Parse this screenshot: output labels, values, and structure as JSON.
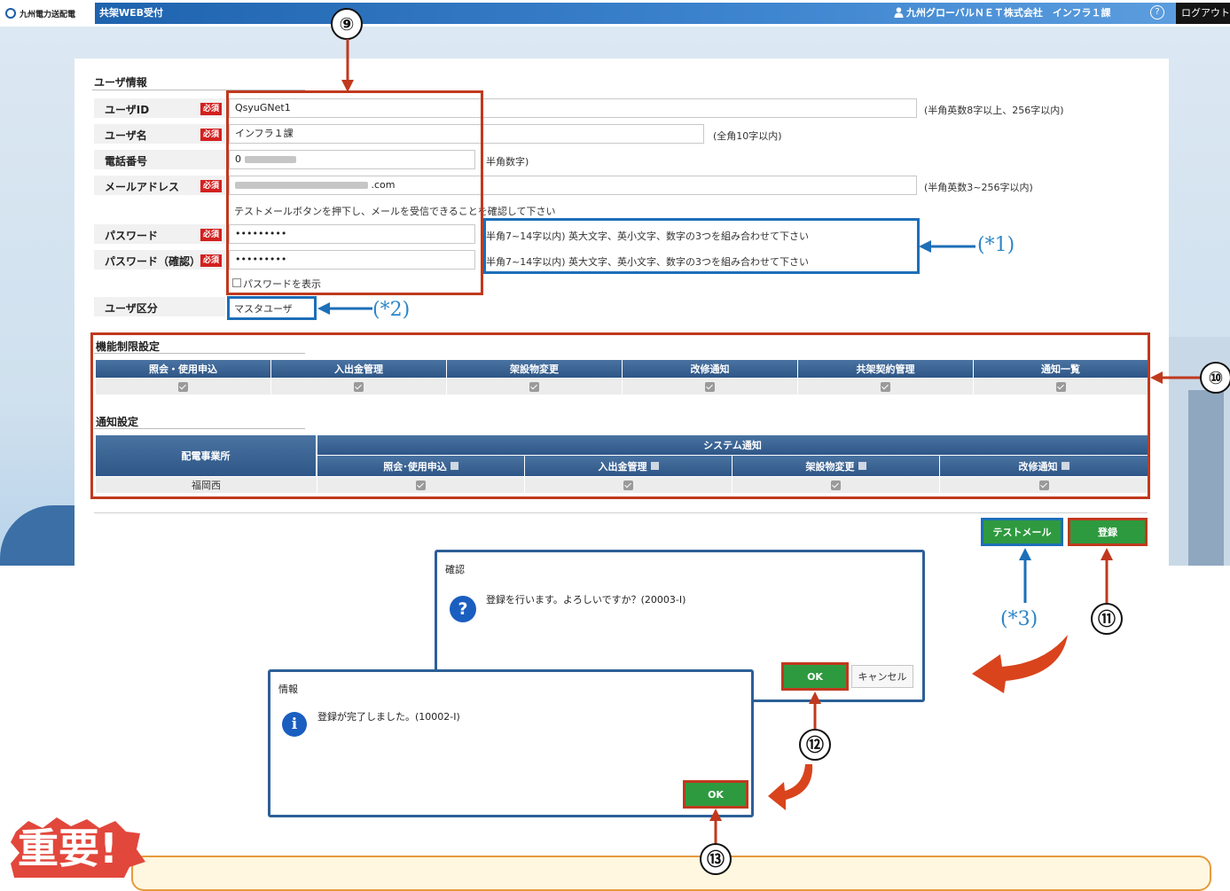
{
  "header": {
    "company_logo": "九州電力送配電",
    "app_title": "共架WEB受付",
    "user_company": "九州グローバルＮＥＴ株式会社　インフラ１課",
    "help_icon": "?",
    "logout_label": "ログアウト"
  },
  "user_info": {
    "section_title": "ユーザ情報",
    "required_badge": "必須",
    "user_id": {
      "label": "ユーザID",
      "value": "QsyuGNet1",
      "hint": "(半角英数8字以上、256字以内)"
    },
    "user_name": {
      "label": "ユーザ名",
      "value": "インフラ１課",
      "hint": "(全角10字以内)"
    },
    "phone": {
      "label": "電話番号",
      "value": "0",
      "hint": "半角数字)"
    },
    "email": {
      "label": "メールアドレス",
      "value": ".com",
      "hint": "(半角英数3~256字以内)"
    },
    "test_mail_note": "テストメールボタンを押下し、メールを受信できることを確認して下さい",
    "password": {
      "label": "パスワード",
      "value": "•••••••••",
      "hint": "半角7~14字以内) 英大文字、英小文字、数字の3つを組み合わせて下さい"
    },
    "password_confirm": {
      "label": "パスワード（確認）",
      "value": "•••••••••",
      "hint": "半角7~14字以内) 英大文字、英小文字、数字の3つを組み合わせて下さい"
    },
    "show_password_label": "パスワードを表示",
    "user_type": {
      "label": "ユーザ区分",
      "value": "マスタユーザ"
    }
  },
  "function_limits": {
    "section_title": "機能制限設定",
    "columns": [
      "照会・使用申込",
      "入出金管理",
      "架設物変更",
      "改修通知",
      "共架契約管理",
      "通知一覧"
    ]
  },
  "notification": {
    "section_title": "通知設定",
    "office_header": "配電事業所",
    "system_header": "システム通知",
    "columns": [
      "照会･使用申込",
      "入出金管理",
      "架設物変更",
      "改修通知"
    ],
    "rows": [
      {
        "office": "福岡西"
      }
    ]
  },
  "actions": {
    "test_mail_label": "テストメール",
    "register_label": "登録"
  },
  "confirm_dialog": {
    "title": "確認",
    "message": "登録を行います。よろしいですか？(20003-I)",
    "ok_label": "OK",
    "cancel_label": "キャンセル"
  },
  "info_dialog": {
    "title": "情報",
    "message": "登録が完了しました。(10002-I)",
    "ok_label": "OK"
  },
  "annotations": {
    "n9": "⑨",
    "n10": "⑩",
    "n11": "⑪",
    "n12": "⑫",
    "n13": "⑬",
    "a1": "(*1)",
    "a2": "(*2)",
    "a3": "(*3)",
    "important": "重要!"
  },
  "colors": {
    "header_blue": "#1e63ae",
    "table_header": "#2e5686",
    "required_red": "#d32020",
    "button_green": "#2e9a3f",
    "annotation_red": "#c0391e",
    "annotation_blue": "#1d6fb8"
  }
}
